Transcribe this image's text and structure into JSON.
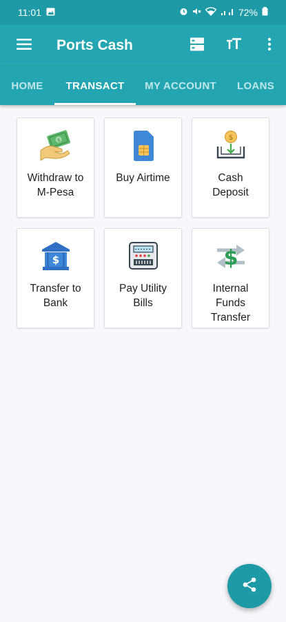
{
  "status_bar": {
    "time": "11:01",
    "battery": "72%"
  },
  "app_bar": {
    "title": "Ports Cash"
  },
  "tabs": [
    {
      "label": "HOME"
    },
    {
      "label": "TRANSACT"
    },
    {
      "label": "MY ACCOUNT"
    },
    {
      "label": "LOANS"
    }
  ],
  "active_tab": "TRANSACT",
  "tiles": [
    {
      "label": "Withdraw to\nM-Pesa",
      "icon": "cash-hand-icon"
    },
    {
      "label": "Buy Airtime",
      "icon": "sim-card-icon"
    },
    {
      "label": "Cash\nDeposit",
      "icon": "cash-deposit-icon"
    },
    {
      "label": "Transfer to\nBank",
      "icon": "bank-icon"
    },
    {
      "label": "Pay Utility\nBills",
      "icon": "utility-meter-icon"
    },
    {
      "label": "Internal\nFunds\nTransfer",
      "icon": "funds-transfer-icon"
    }
  ],
  "colors": {
    "primary": "#23a6b1",
    "status_bar": "#1d9aa6",
    "background": "#f7f8fb"
  }
}
